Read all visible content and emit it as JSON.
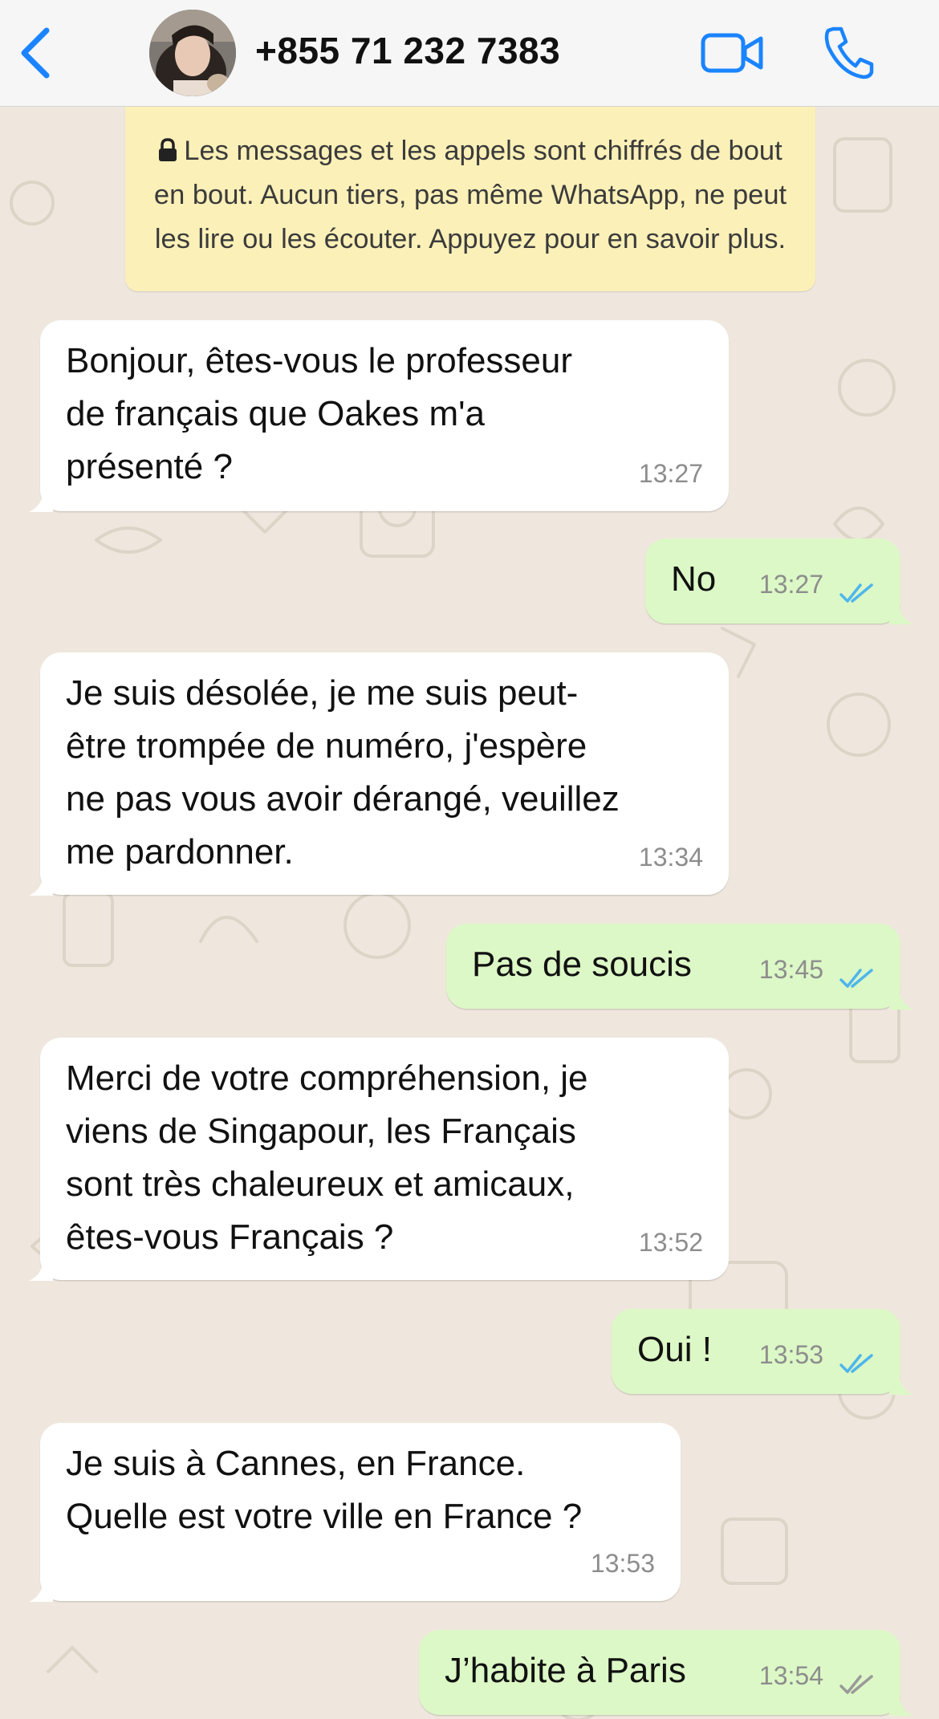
{
  "header": {
    "contact": "+855 71 232 7383"
  },
  "icons": {
    "back": "chevron-left-icon",
    "video": "video-camera-icon",
    "call": "phone-icon",
    "lock": "lock-icon",
    "read_receipt": "double-check-icon"
  },
  "colors": {
    "accent": "#1a84ff",
    "incoming_bubble": "#ffffff",
    "outgoing_bubble": "#dcf8c6",
    "notice_bg": "#fbf0b8",
    "read_ticks": "#4fb6ec",
    "delivered_ticks": "#9a9a9a"
  },
  "notice": {
    "text": "Les messages et les appels sont chiffrés de bout en bout. Aucun tiers, pas même WhatsApp, ne peut les lire ou les écouter. Appuyez pour en savoir plus."
  },
  "messages": [
    {
      "direction": "in",
      "text": "Bonjour, êtes-vous le professeur\nde français que Oakes m'a\nprésenté ?",
      "time": "13:27"
    },
    {
      "direction": "out",
      "text": "No",
      "time": "13:27",
      "status": "read"
    },
    {
      "direction": "in",
      "text": "Je suis désolée, je me suis peut-\nêtre trompée de numéro, j'espère\nne pas vous avoir dérangé, veuillez\nme pardonner.",
      "time": "13:34"
    },
    {
      "direction": "out",
      "text": "Pas de soucis",
      "time": "13:45",
      "status": "read"
    },
    {
      "direction": "in",
      "text": "Merci de votre compréhension, je\nviens de Singapour, les Français\nsont très chaleureux et amicaux,\nêtes-vous Français ?",
      "time": "13:52"
    },
    {
      "direction": "out",
      "text": "Oui !",
      "time": "13:53",
      "status": "read"
    },
    {
      "direction": "in",
      "text": "Je suis à Cannes, en France.\nQuelle est votre ville en France ?",
      "time": "13:53"
    },
    {
      "direction": "out",
      "text": "J’habite à Paris",
      "time": "13:54",
      "status": "delivered"
    }
  ]
}
